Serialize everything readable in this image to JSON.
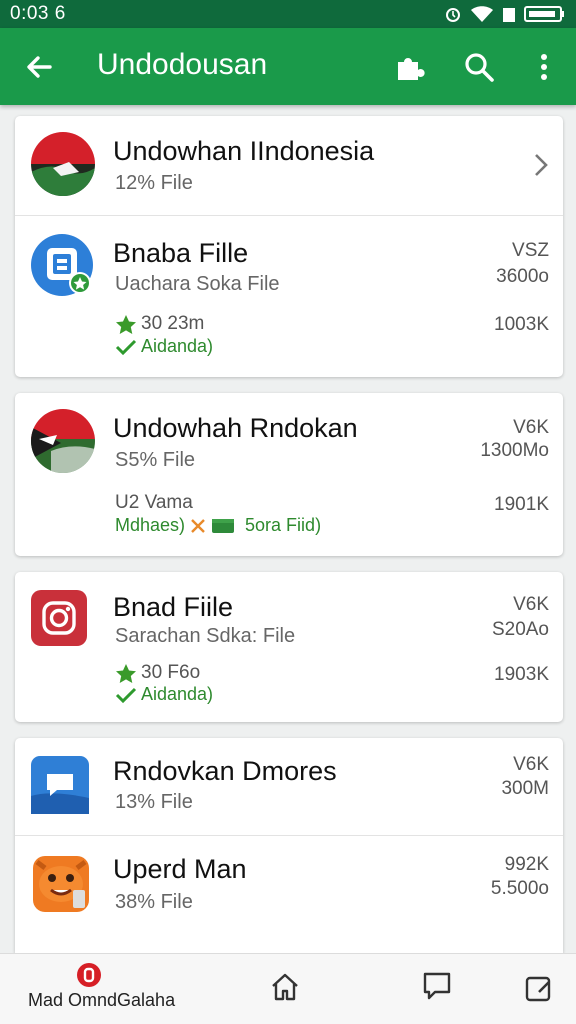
{
  "status_bar": {
    "time": "0:03 6"
  },
  "app_bar": {
    "title": "Undodousan"
  },
  "items": [
    {
      "name": "Undowhan IIndonesia",
      "sub": "12% File"
    },
    {
      "name": "Bnaba Fille",
      "sub": "Uachara Soka File",
      "meta1": "VSZ",
      "meta2": "3600o",
      "line3": "30 23m",
      "meta3": "1003K",
      "status": "Aidanda)"
    },
    {
      "name": "Undowhah Rndokan",
      "sub": "S5% File",
      "meta1": "V6K",
      "meta2": "1300Mo",
      "line3": "U2 Vama",
      "meta3": "1901K",
      "status": "Mdhaes)",
      "status_extra": "5ora Fiid)"
    },
    {
      "name": "Bnad Fiile",
      "sub": "Sarachan Sdka: File",
      "meta1": "V6K",
      "meta2": "S20Ao",
      "line3": "30 F6o",
      "meta3": "1903K",
      "status": "Aidanda)"
    },
    {
      "name": "Rndovkan Dmores",
      "sub": "13% File",
      "meta1": "V6K",
      "meta2": "300M"
    },
    {
      "name": "Uperd Man",
      "sub": "38% File",
      "meta1": "992K",
      "meta2": "5.500o"
    }
  ],
  "bottom_nav": {
    "label": "Mad OmndGalaha"
  },
  "colors": {
    "app_bar": "#1a9a4a",
    "status_bar": "#0f6a3c",
    "accent_green": "#2e8a2e"
  },
  "icons": [
    "back-arrow-icon",
    "puzzle-icon",
    "search-icon",
    "more-vert-icon",
    "flag-icon",
    "file-app-icon",
    "instagram-icon",
    "chat-icon",
    "mascot-icon",
    "home-icon",
    "chat-bubble-icon",
    "edit-box-icon"
  ]
}
